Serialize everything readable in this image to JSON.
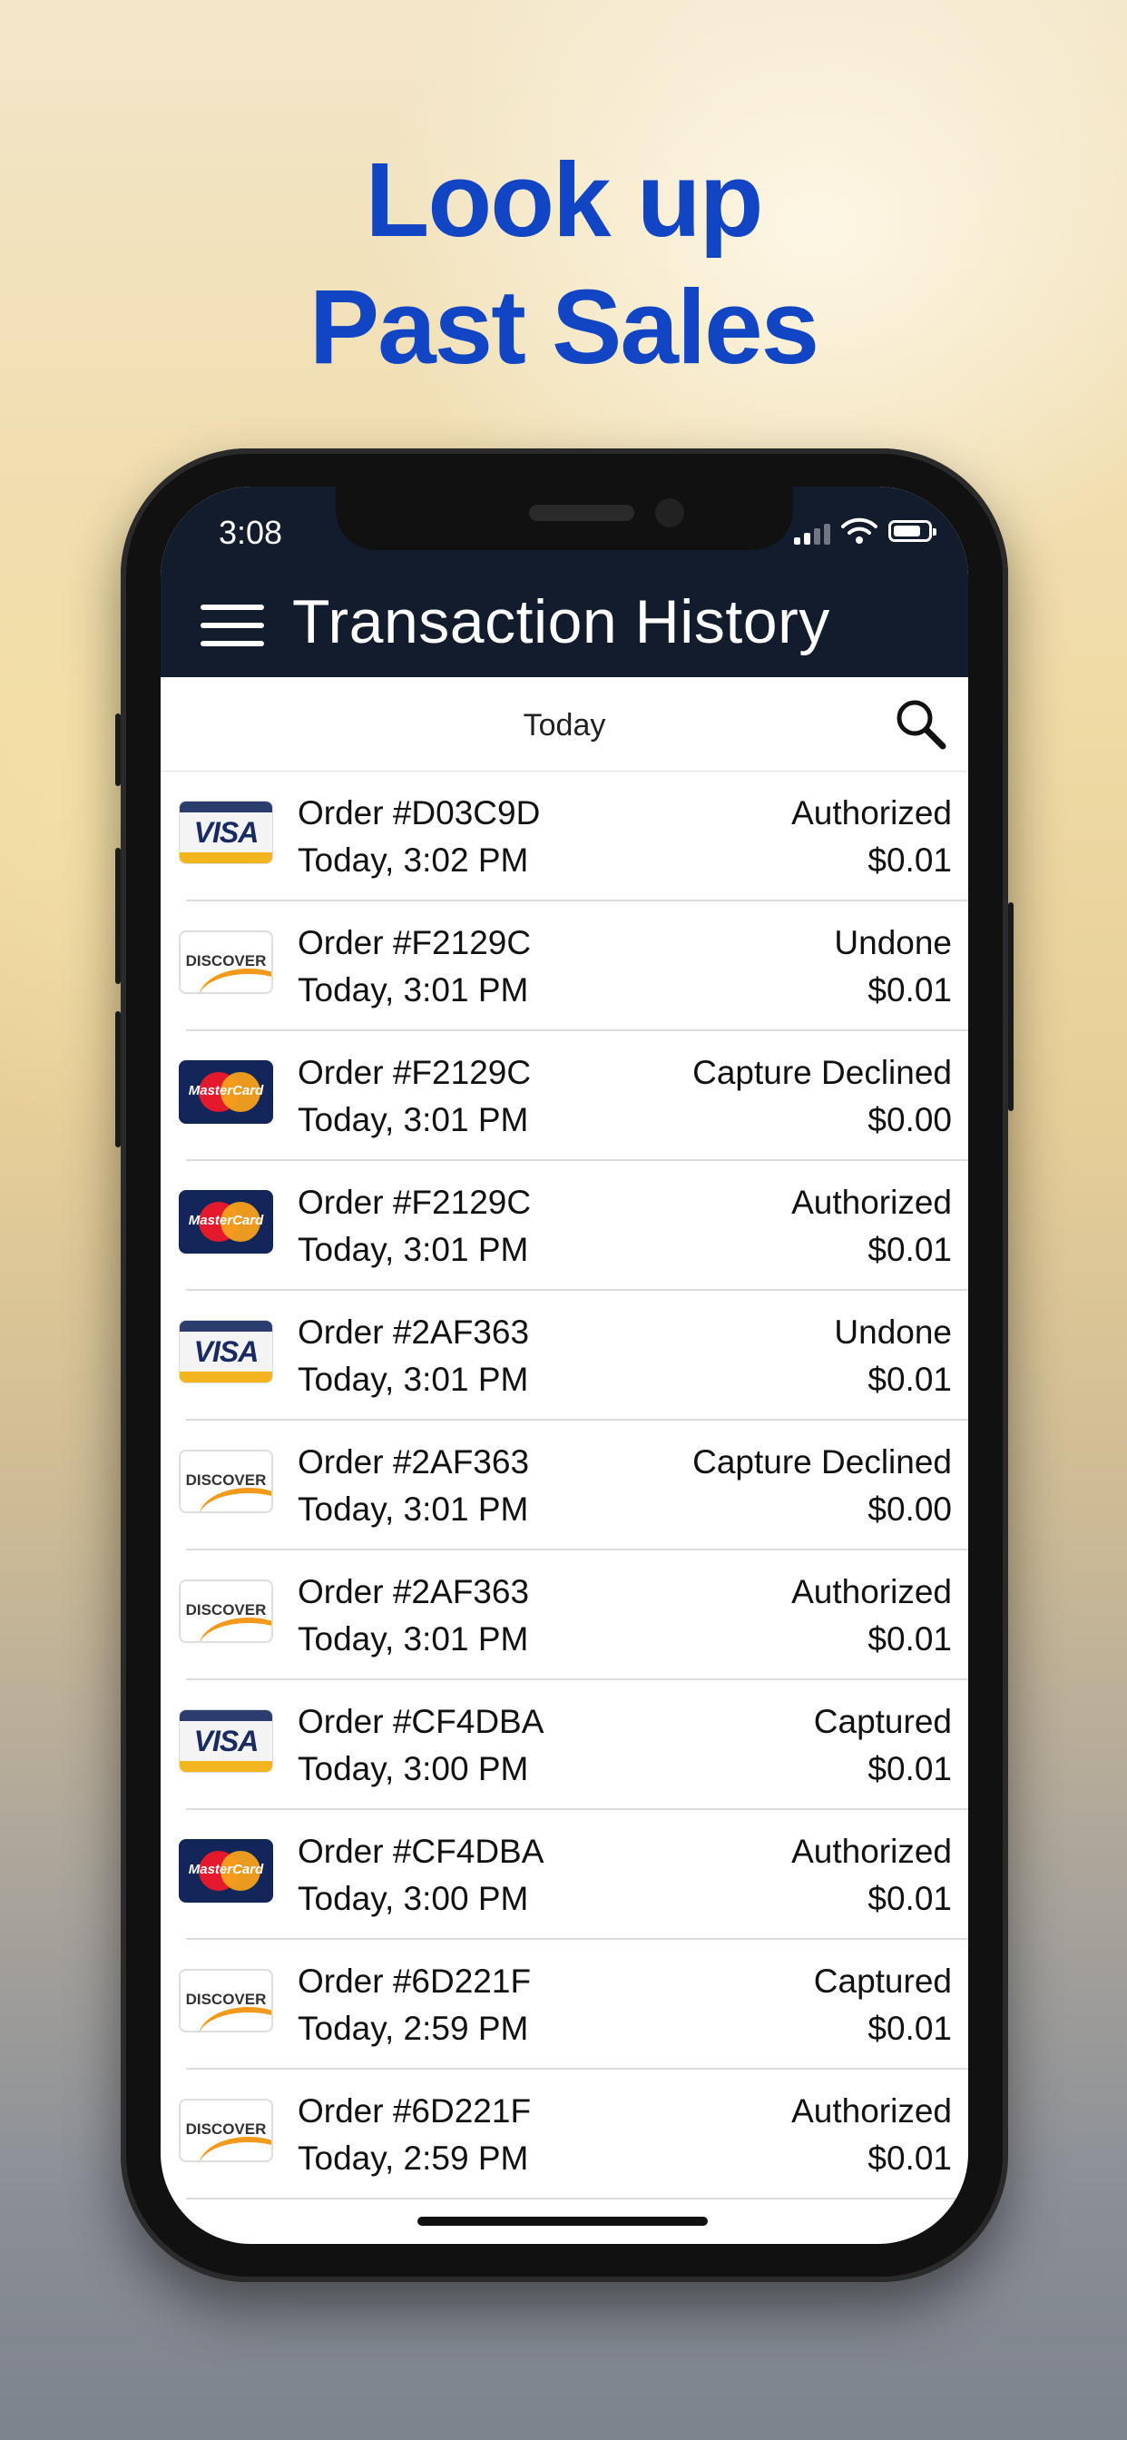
{
  "headline": {
    "line1": "Look up",
    "line2": "Past Sales"
  },
  "status_bar": {
    "time": "3:08"
  },
  "header": {
    "title": "Transaction History"
  },
  "filter": {
    "date_label": "Today"
  },
  "transactions": [
    {
      "card": "visa",
      "card_label": "VISA",
      "order": "Order #D03C9D",
      "time": "Today, 3:02 PM",
      "status": "Authorized",
      "amount": "$0.01"
    },
    {
      "card": "discover",
      "card_label": "DISCOVER",
      "order": "Order #F2129C",
      "time": "Today, 3:01 PM",
      "status": "Undone",
      "amount": "$0.01"
    },
    {
      "card": "mastercard",
      "card_label": "MasterCard",
      "order": "Order #F2129C",
      "time": "Today, 3:01 PM",
      "status": "Capture Declined",
      "amount": "$0.00"
    },
    {
      "card": "mastercard",
      "card_label": "MasterCard",
      "order": "Order #F2129C",
      "time": "Today, 3:01 PM",
      "status": "Authorized",
      "amount": "$0.01"
    },
    {
      "card": "visa",
      "card_label": "VISA",
      "order": "Order #2AF363",
      "time": "Today, 3:01 PM",
      "status": "Undone",
      "amount": "$0.01"
    },
    {
      "card": "discover",
      "card_label": "DISCOVER",
      "order": "Order #2AF363",
      "time": "Today, 3:01 PM",
      "status": "Capture Declined",
      "amount": "$0.00"
    },
    {
      "card": "discover",
      "card_label": "DISCOVER",
      "order": "Order #2AF363",
      "time": "Today, 3:01 PM",
      "status": "Authorized",
      "amount": "$0.01"
    },
    {
      "card": "visa",
      "card_label": "VISA",
      "order": "Order #CF4DBA",
      "time": "Today, 3:00 PM",
      "status": "Captured",
      "amount": "$0.01"
    },
    {
      "card": "mastercard",
      "card_label": "MasterCard",
      "order": "Order #CF4DBA",
      "time": "Today, 3:00 PM",
      "status": "Authorized",
      "amount": "$0.01"
    },
    {
      "card": "discover",
      "card_label": "DISCOVER",
      "order": "Order #6D221F",
      "time": "Today, 2:59 PM",
      "status": "Captured",
      "amount": "$0.01"
    },
    {
      "card": "discover",
      "card_label": "DISCOVER",
      "order": "Order #6D221F",
      "time": "Today, 2:59 PM",
      "status": "Authorized",
      "amount": "$0.01"
    }
  ],
  "colors": {
    "headline": "#1145c4",
    "header_bg": "#131c2c"
  },
  "icons": {
    "menu": "hamburger-menu-icon",
    "search": "search-icon"
  }
}
